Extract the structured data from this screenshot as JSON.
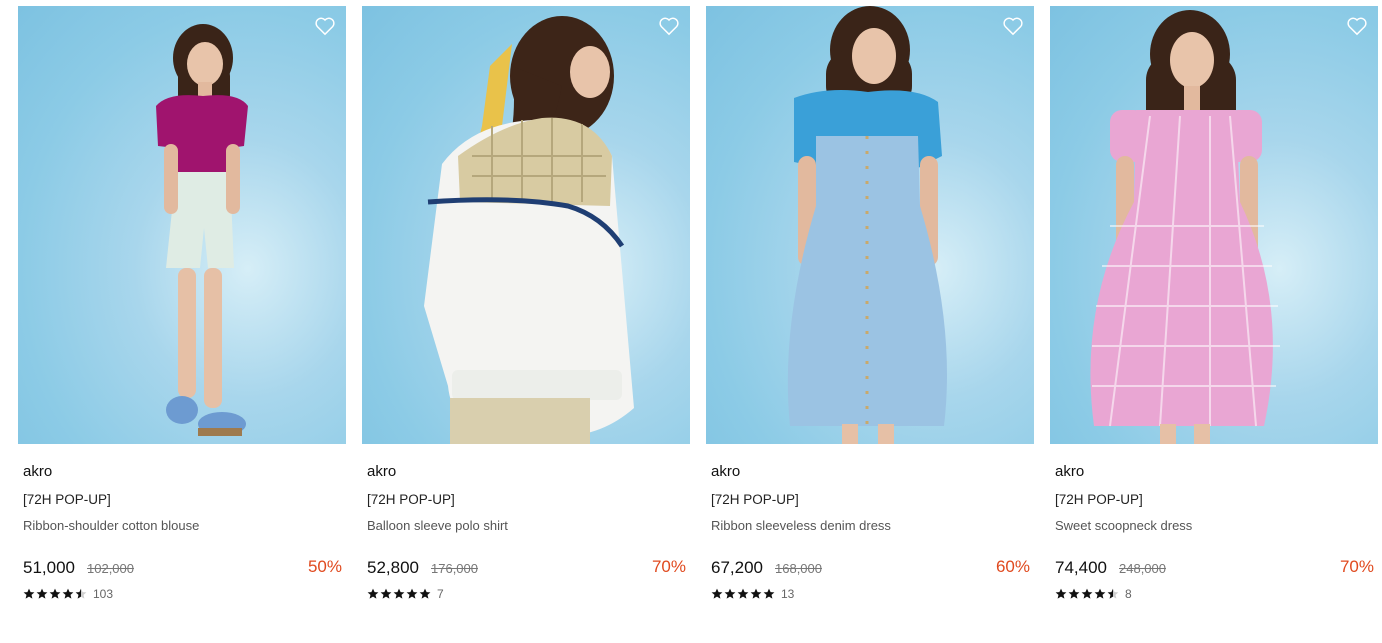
{
  "products": [
    {
      "brand": "akro",
      "tag": "[72H POP-UP]",
      "title": "Ribbon-shoulder cotton blouse",
      "price": "51,000",
      "original_price": "102,000",
      "discount": "50%",
      "rating": 4.5,
      "review_count": "103",
      "image_colors": {
        "top": "#a0146e",
        "bottom": "#dfece4",
        "shoes": "#6d9bd1"
      }
    },
    {
      "brand": "akro",
      "tag": "[72H POP-UP]",
      "title": "Balloon sleeve polo shirt",
      "price": "52,800",
      "original_price": "176,000",
      "discount": "70%",
      "rating": 5,
      "review_count": "7",
      "image_colors": {
        "top": "#f4f4f2",
        "bottom": "#d9cfae",
        "shoes": "#c7b07a"
      }
    },
    {
      "brand": "akro",
      "tag": "[72H POP-UP]",
      "title": "Ribbon sleeveless denim dress",
      "price": "67,200",
      "original_price": "168,000",
      "discount": "60%",
      "rating": 5,
      "review_count": "13",
      "image_colors": {
        "top": "#9bc3e3",
        "bottom": "#a9c9e6",
        "shoes": "#3aa0d8"
      }
    },
    {
      "brand": "akro",
      "tag": "[72H POP-UP]",
      "title": "Sweet scoopneck dress",
      "price": "74,400",
      "original_price": "248,000",
      "discount": "70%",
      "rating": 4.5,
      "review_count": "8",
      "image_colors": {
        "top": "#e9a6d3",
        "bottom": "#e38fc8",
        "shoes": "#e9a6d3"
      }
    }
  ],
  "colors": {
    "discount": "#e04a1f",
    "background_photo": "#8ccbe6"
  },
  "icons": {
    "wishlist": "heart-outline-icon",
    "star": "star-icon"
  }
}
